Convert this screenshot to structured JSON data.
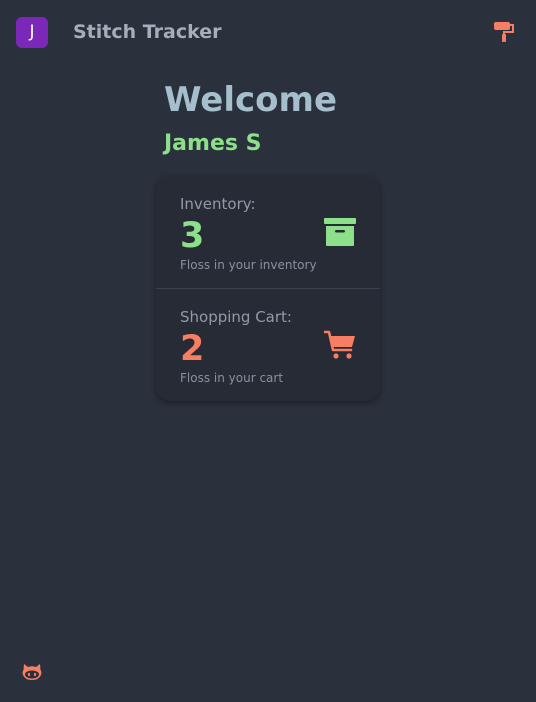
{
  "navbar": {
    "avatar_letter": "J",
    "title": "Stitch Tracker",
    "theme_icon": "paint-roller-icon"
  },
  "hero": {
    "welcome": "Welcome",
    "user_name": "James S"
  },
  "stats": {
    "inventory": {
      "title": "Inventory:",
      "value": "3",
      "desc": "Floss in your inventory",
      "icon": "archive-box-icon",
      "color": "#8ce08a"
    },
    "cart": {
      "title": "Shopping Cart:",
      "value": "2",
      "desc": "Floss in your cart",
      "icon": "shopping-cart-icon",
      "color": "#f87e63"
    }
  },
  "footer": {
    "icon": "github-icon"
  },
  "colors": {
    "background": "#2a303c",
    "avatar": "#7b28b8",
    "accent": "#f87e63",
    "success": "#8ce08a"
  }
}
